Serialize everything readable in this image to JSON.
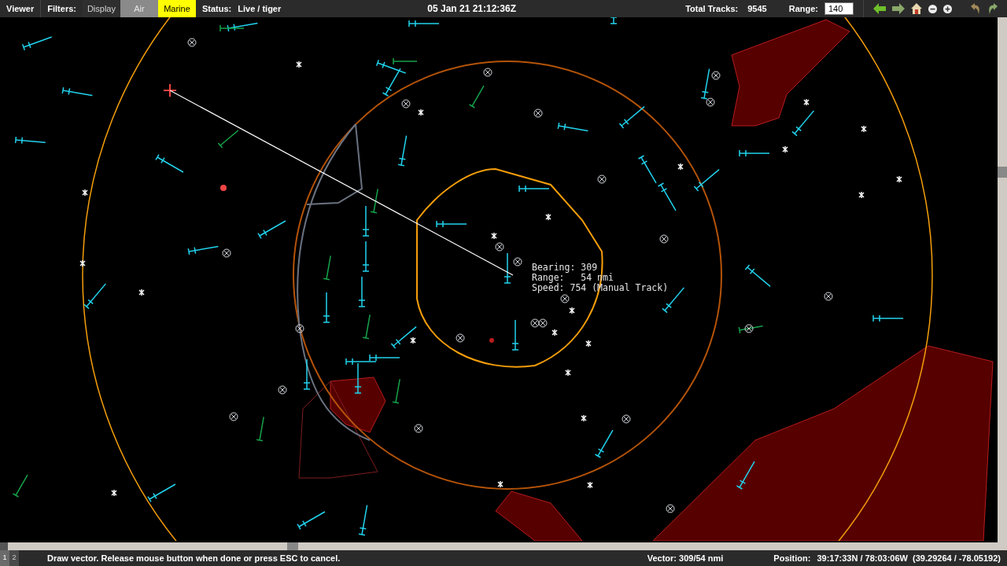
{
  "toolbar": {
    "menu": "Viewer",
    "filters_label": "Filters:",
    "filters": [
      {
        "label": "Display",
        "selected": false,
        "disabled": false
      },
      {
        "label": "Air",
        "selected": false,
        "disabled": true
      },
      {
        "label": "Marine",
        "selected": true,
        "disabled": false
      }
    ],
    "status_label": "Status:",
    "status": "Live / tiger",
    "datetime": "05 Jan 21 21:12:36Z",
    "tracks_label": "Total Tracks:",
    "tracks": "9545",
    "range_label": "Range:",
    "range": "140"
  },
  "readout": [
    "Bearing: 309",
    "Range:   54 nmi",
    "Speed: 754 (Manual Track)"
  ],
  "status_bar": {
    "pages": [
      {
        "label": "1",
        "selected": true
      },
      {
        "label": "2",
        "selected": false
      }
    ],
    "message": "Draw vector. Release mouse button when done or press ESC to cancel.",
    "vector": "Vector: 309/54 nmi",
    "position_label": "Position:",
    "position": "39:17:33N / 78:03:06W  (39.29264 / -78.05192)"
  }
}
